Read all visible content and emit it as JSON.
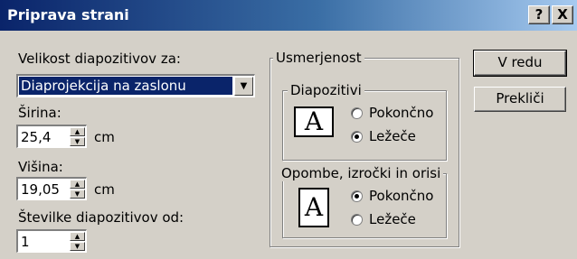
{
  "window": {
    "title": "Priprava strani",
    "help_label": "?",
    "close_label": "X"
  },
  "size": {
    "label": "Velikost diapozitivov za:",
    "selected": "Diaprojekcija na zaslonu"
  },
  "width": {
    "label": "Širina:",
    "value": "25,4",
    "unit": "cm"
  },
  "height": {
    "label": "Višina:",
    "value": "19,05",
    "unit": "cm"
  },
  "numbering": {
    "label": "Številke diapozitivov od:",
    "value": "1"
  },
  "orientation": {
    "title": "Usmerjenost",
    "slides": {
      "title": "Diapozitivi",
      "icon_letter": "A",
      "portrait_label": "Pokončno",
      "landscape_label": "Ležeče",
      "selected": "landscape"
    },
    "notes": {
      "title": "Opombe, izročki in orisi",
      "icon_letter": "A",
      "portrait_label": "Pokončno",
      "landscape_label": "Ležeče",
      "selected": "portrait"
    }
  },
  "buttons": {
    "ok_label": "V redu",
    "cancel_label": "Prekliči"
  }
}
